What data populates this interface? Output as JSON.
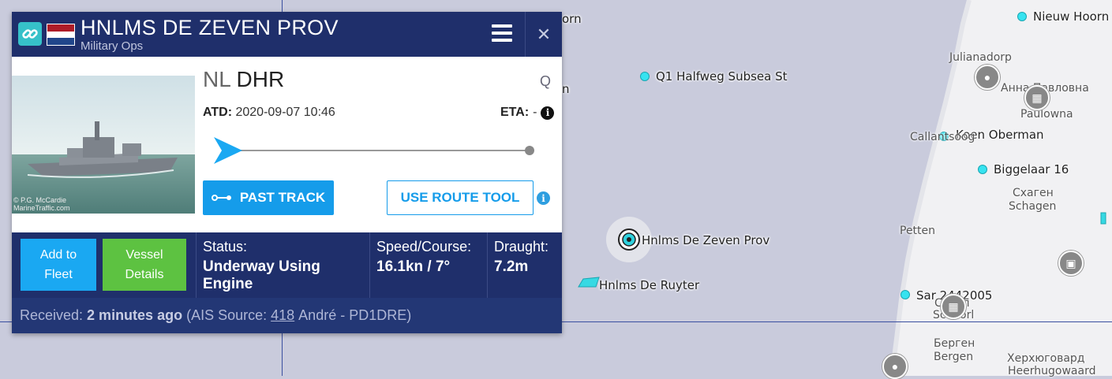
{
  "vessel": {
    "name": "HNLMS DE ZEVEN PROV",
    "type": "Military Ops",
    "flag_colors": [
      "#ae1c28",
      "#ffffff",
      "#21468b"
    ],
    "departure": "NL",
    "destination": "DHR",
    "search_label": "Q",
    "atd_label": "ATD:",
    "atd_value": "2020-09-07 10:46",
    "eta_label": "ETA:",
    "eta_value": "-",
    "photo_caption": "© P.G. McCardie\nMarineTraffic.com"
  },
  "actions": {
    "past_track": "PAST TRACK",
    "route_tool": "USE ROUTE TOOL",
    "add_to_fleet": "Add to\nFleet",
    "vessel_details": "Vessel\nDetails"
  },
  "status": {
    "status_label": "Status:",
    "status_value": "Underway Using Engine",
    "speed_label": "Speed/Course:",
    "speed_value": "16.1kn / 7°",
    "draught_label": "Draught:",
    "draught_value": "7.2m"
  },
  "footer": {
    "received_label": "Received:",
    "received_value": "2 minutes ago",
    "source_prefix": "(AIS Source:",
    "source_id": "418",
    "source_suffix": "André - PD1DRE)"
  },
  "map": {
    "labels": {
      "partial_orn": "orn",
      "partial_n": "n",
      "halfweg": "Q1 Halfweg Subsea St",
      "nieuw_hoorn": "Nieuw Hoorn",
      "koen_oberman": "Koen Oberman",
      "biggelaar": "Biggelaar 16",
      "hnlms_zeven": "Hnlms De Zeven Prov",
      "hnlms_ruyter": "Hnlms De Ruyter",
      "sar": "Sar 2442005"
    },
    "places": {
      "julianadorp": "Julianadorp",
      "anna_ru": "Анна Павловна",
      "anna_nl": "Paulowna",
      "callantsoog": "Callantsoog",
      "schagen_ru": "Схаген",
      "schagen_nl": "Schagen",
      "petten": "Petten",
      "schoorl_ru": "Схорл",
      "schoorl_nl": "Schoorl",
      "bergen_ru": "Берген",
      "bergen_nl": "Bergen",
      "heerhugo_ru": "Херхюговард",
      "heerhugo_nl": "Heerhugowaard"
    }
  }
}
